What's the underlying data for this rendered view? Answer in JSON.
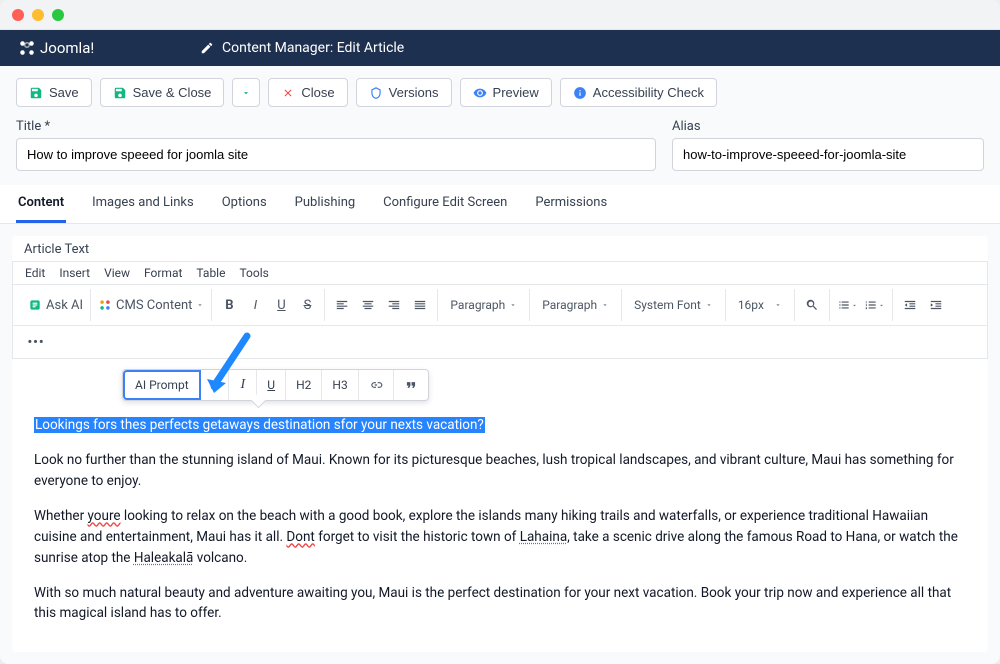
{
  "window": {
    "brand": "Joomla!",
    "section": "Content Manager: Edit Article"
  },
  "toolbar": {
    "save": "Save",
    "save_close": "Save & Close",
    "close": "Close",
    "versions": "Versions",
    "preview": "Preview",
    "accessibility": "Accessibility Check"
  },
  "form": {
    "title_label": "Title *",
    "title_value": "How to improve speeed for joomla site",
    "alias_label": "Alias",
    "alias_value": "how-to-improve-speeed-for-joomla-site"
  },
  "tabs": [
    "Content",
    "Images and Links",
    "Options",
    "Publishing",
    "Configure Edit Screen",
    "Permissions"
  ],
  "editor": {
    "article_label": "Article Text",
    "menu": [
      "Edit",
      "Insert",
      "View",
      "Format",
      "Table",
      "Tools"
    ],
    "ask_ai": "Ask AI",
    "cms_content": "CMS Content",
    "para1": "Paragraph",
    "para2": "Paragraph",
    "font": "System Font",
    "size": "16px"
  },
  "floating": {
    "ai_prompt": "AI Prompt",
    "h2": "H2",
    "h3": "H3"
  },
  "article": {
    "highlight": "Lookings fors thes perfects getaways destination sfor your nexts vacation?",
    "p1": "Look no further than the stunning island of Maui. Known for its picturesque beaches, lush tropical landscapes, and vibrant culture, Maui has something for everyone to enjoy.",
    "p2_a": "Whether ",
    "p2_err1": "youre",
    "p2_b": " looking to relax on the beach with a good book, explore the islands many hiking trails and waterfalls, or experience traditional Hawaiian cuisine and entertainment, Maui has it all. ",
    "p2_err2": "Dont",
    "p2_c": " forget to visit the historic town of ",
    "p2_d1": "Lahaina",
    "p2_d": ", take a scenic drive along the famous Road to Hana, or watch the sunrise atop the ",
    "p2_d2": "Haleakalā",
    "p2_e": " volcano.",
    "p3": "With so much natural beauty and adventure awaiting you, Maui is the perfect destination for your next vacation. Book your trip now and experience all that this magical island has to offer."
  },
  "colors": {
    "close": "#ff5f57",
    "min": "#febc2e",
    "max": "#28c840",
    "header": "#1e3050",
    "accent": "#2563eb"
  }
}
